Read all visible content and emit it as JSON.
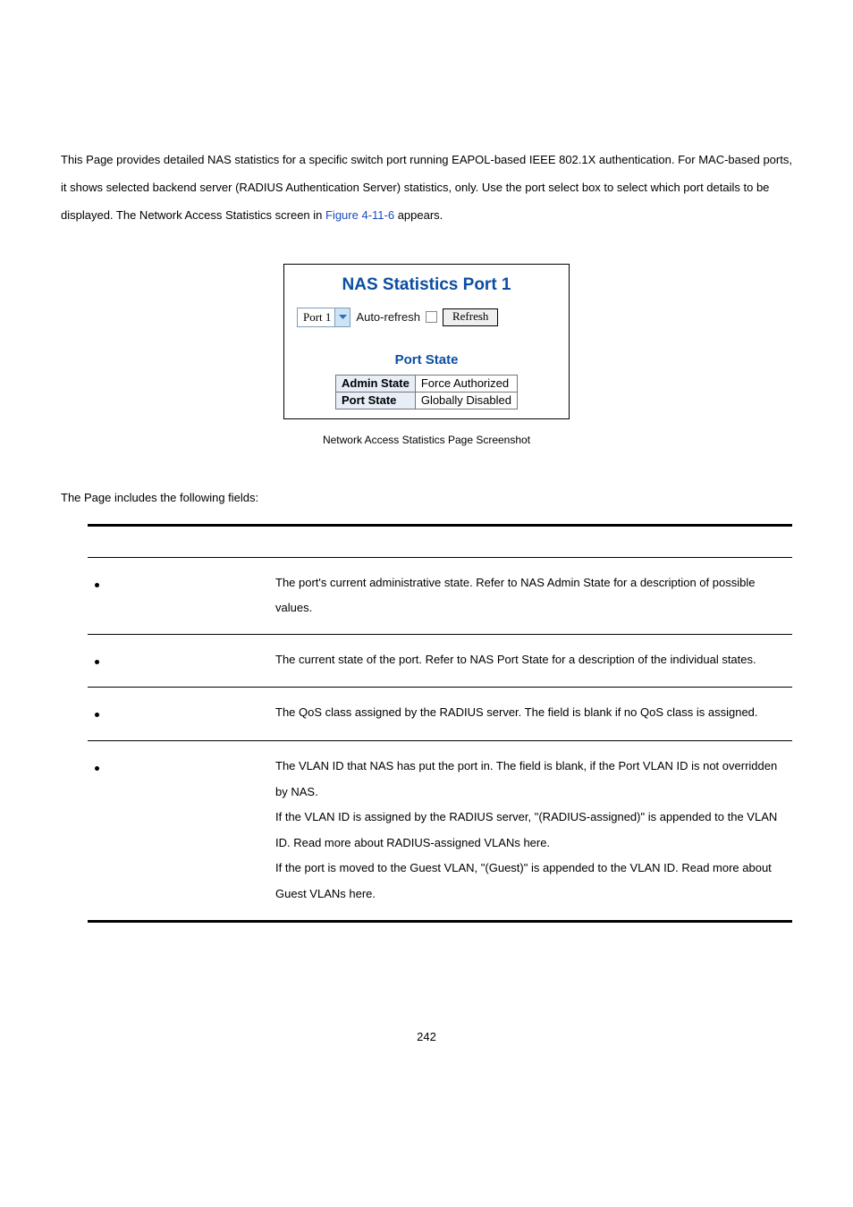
{
  "intro": {
    "pre": "This Page provides detailed NAS statistics for a specific switch port running EAPOL-based IEEE 802.1X authentication. For MAC-based ports, it shows selected backend server (RADIUS Authentication Server) statistics, only. Use the port select box to select which port details to be displayed. The Network Access Statistics screen in ",
    "figref": "Figure 4-11-6",
    "post": " appears."
  },
  "screenshot": {
    "title": "NAS Statistics  Port 1",
    "port_select": {
      "value": "Port 1"
    },
    "auto_refresh_label": "Auto-refresh",
    "refresh_button": "Refresh",
    "port_state_title": "Port State",
    "rows": [
      {
        "label": "Admin State",
        "value": "Force Authorized"
      },
      {
        "label": "Port State",
        "value": "Globally Disabled"
      }
    ]
  },
  "caption": "Network Access Statistics Page Screenshot",
  "lead": "The Page includes the following fields:",
  "fields": [
    {
      "desc": "The port's current administrative state. Refer to NAS Admin State for a description of possible values."
    },
    {
      "desc": "The current state of the port. Refer to NAS Port State for a description of the individual states."
    },
    {
      "desc": "The QoS class assigned by the RADIUS server. The field is blank if no QoS class is assigned."
    },
    {
      "desc": "The VLAN ID that NAS has put the port in. The field is blank, if the Port VLAN ID is not overridden by NAS.\nIf the VLAN ID is assigned by the RADIUS server, \"(RADIUS-assigned)\" is appended to the VLAN ID. Read more about RADIUS-assigned VLANs here.\nIf the port is moved to the Guest VLAN, \"(Guest)\" is appended to the VLAN ID. Read more about Guest VLANs here."
    }
  ],
  "page_number": "242"
}
